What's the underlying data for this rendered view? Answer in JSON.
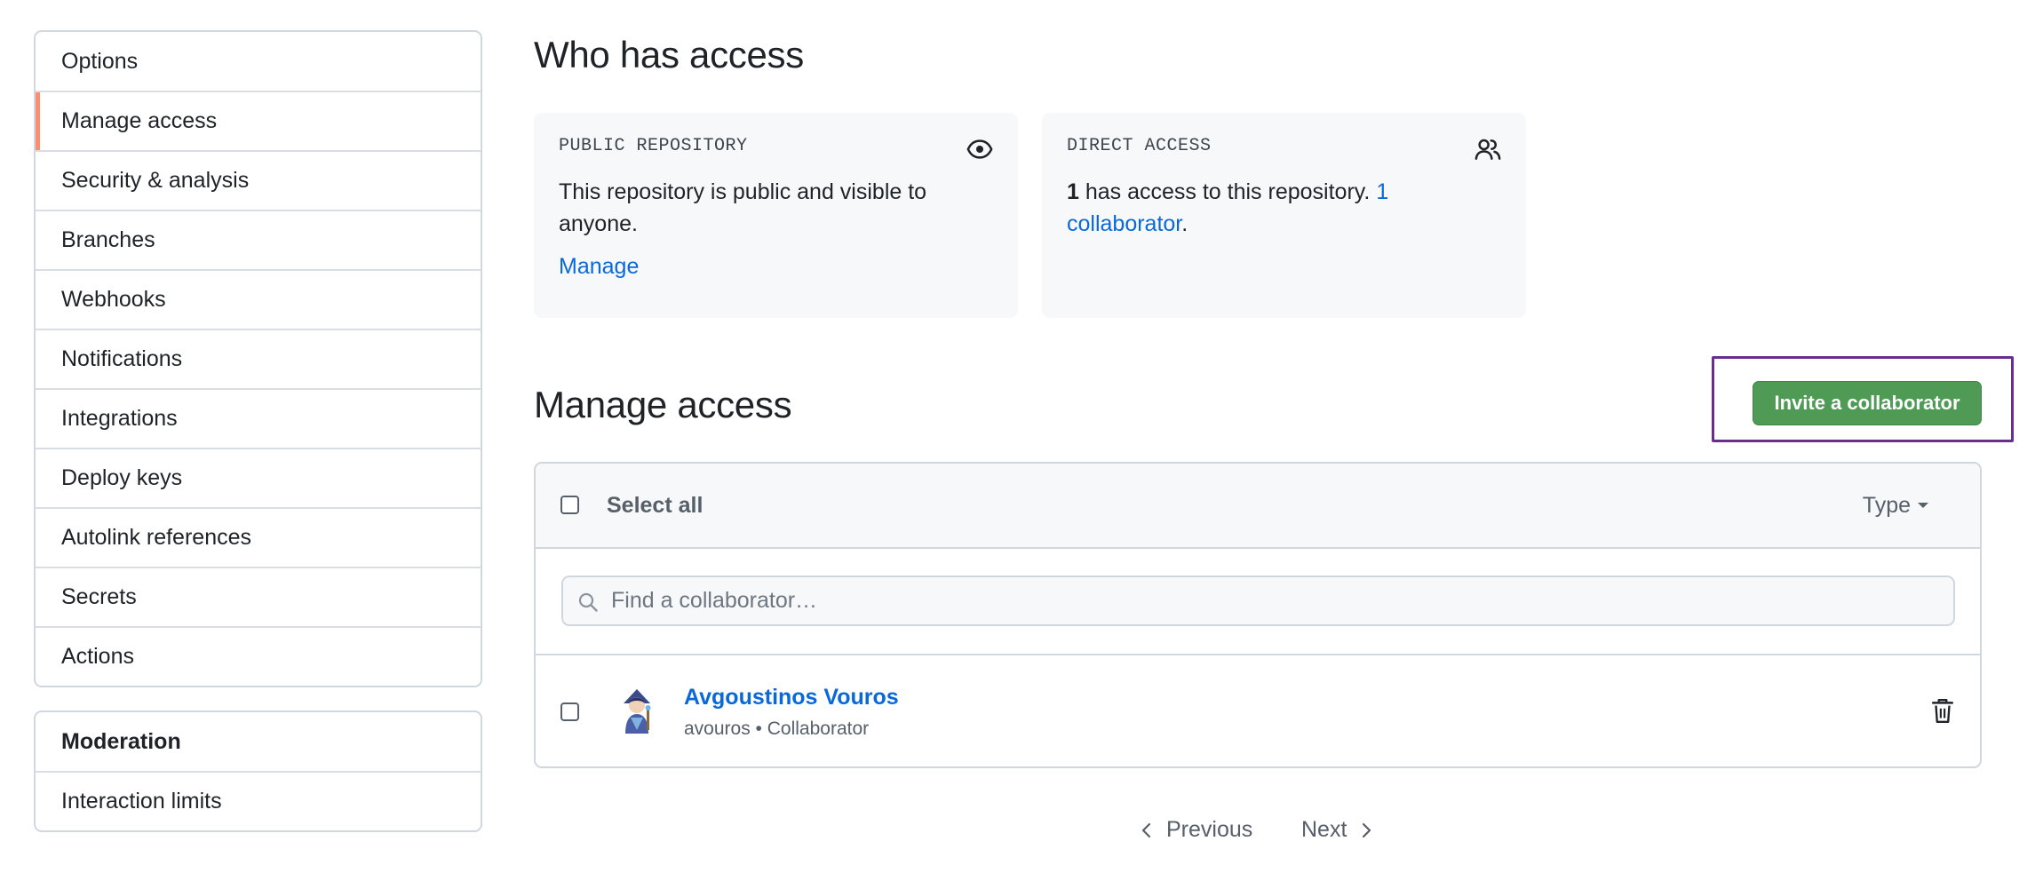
{
  "sidebar": {
    "items": [
      {
        "label": "Options"
      },
      {
        "label": "Manage access",
        "selected": true
      },
      {
        "label": "Security & analysis"
      },
      {
        "label": "Branches"
      },
      {
        "label": "Webhooks"
      },
      {
        "label": "Notifications"
      },
      {
        "label": "Integrations"
      },
      {
        "label": "Deploy keys"
      },
      {
        "label": "Autolink references"
      },
      {
        "label": "Secrets"
      },
      {
        "label": "Actions"
      }
    ],
    "moderation": {
      "heading": "Moderation",
      "items": [
        {
          "label": "Interaction limits"
        }
      ]
    },
    "selected_accent": "#fd8c73"
  },
  "who_has_access": {
    "title": "Who has access",
    "public_card": {
      "label": "PUBLIC REPOSITORY",
      "icon": "eye-icon",
      "text": "This repository is public and visible to anyone.",
      "link": "Manage"
    },
    "direct_card": {
      "label": "DIRECT ACCESS",
      "icon": "people-icon",
      "count": "1",
      "text": " has access to this repository. ",
      "link": "1 collaborator",
      "suffix": "."
    }
  },
  "manage_access": {
    "title": "Manage access",
    "invite_button": "Invite a collaborator",
    "invite_button_color": "#4f9a55",
    "highlight_color": "#6a2c8e",
    "table": {
      "select_all": "Select all",
      "type_filter": "Type",
      "search_placeholder": "Find a collaborator…",
      "members": [
        {
          "name": "Avgoustinos Vouros",
          "username": "avouros",
          "role": "Collaborator",
          "meta": "avouros • Collaborator",
          "avatar": "avatar",
          "action_icon": "trash-icon"
        }
      ]
    },
    "pagination": {
      "previous": "Previous",
      "next": "Next"
    }
  }
}
